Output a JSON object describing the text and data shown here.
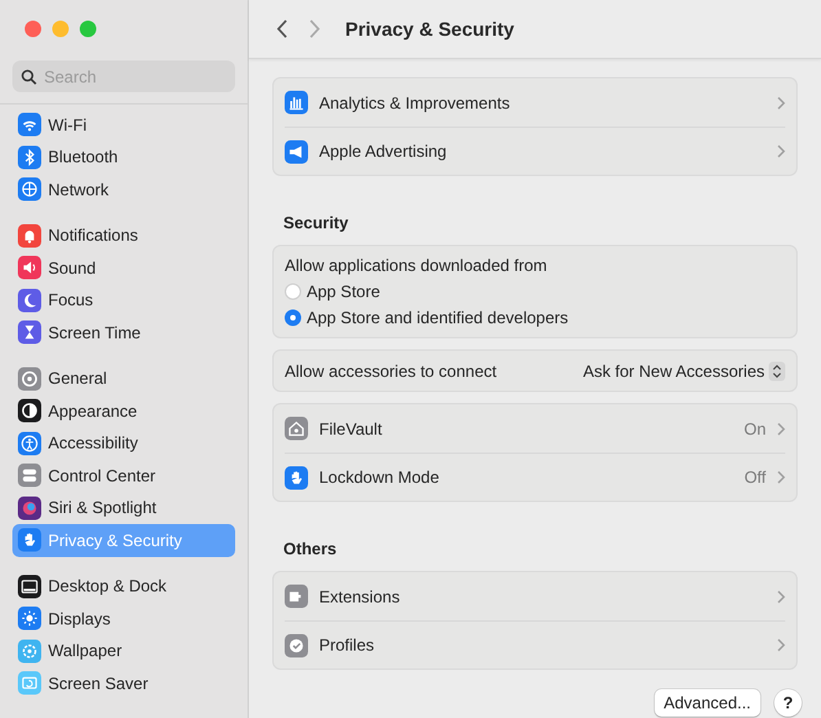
{
  "window": {
    "title": "Privacy & Security"
  },
  "sidebar": {
    "search": {
      "placeholder": "Search"
    },
    "groups": [
      [
        {
          "label": "Wi-Fi",
          "selected": false
        },
        {
          "label": "Bluetooth",
          "selected": false
        },
        {
          "label": "Network",
          "selected": false
        }
      ],
      [
        {
          "label": "Notifications",
          "selected": false
        },
        {
          "label": "Sound",
          "selected": false
        },
        {
          "label": "Focus",
          "selected": false
        },
        {
          "label": "Screen Time",
          "selected": false
        }
      ],
      [
        {
          "label": "General",
          "selected": false
        },
        {
          "label": "Appearance",
          "selected": false
        },
        {
          "label": "Accessibility",
          "selected": false
        },
        {
          "label": "Control Center",
          "selected": false
        },
        {
          "label": "Siri & Spotlight",
          "selected": false
        },
        {
          "label": "Privacy & Security",
          "selected": true
        }
      ],
      [
        {
          "label": "Desktop & Dock",
          "selected": false
        },
        {
          "label": "Displays",
          "selected": false
        },
        {
          "label": "Wallpaper",
          "selected": false
        },
        {
          "label": "Screen Saver",
          "selected": false
        }
      ]
    ]
  },
  "sections": [
    {
      "cards": [
        [
          {
            "kind": "nav",
            "label": "Analytics & Improvements"
          },
          {
            "kind": "nav",
            "label": "Apple Advertising"
          }
        ]
      ]
    },
    {
      "heading": "Security",
      "cards": [
        [
          {
            "kind": "radios",
            "label": "Allow applications downloaded from",
            "options": [
              {
                "label": "App Store",
                "selected": false
              },
              {
                "label": "App Store and identified developers",
                "selected": true
              }
            ]
          }
        ],
        [
          {
            "kind": "popup",
            "label": "Allow accessories to connect",
            "value": "Ask for New Accessories"
          }
        ],
        [
          {
            "kind": "nav",
            "label": "FileVault",
            "value": "On"
          },
          {
            "kind": "nav",
            "label": "Lockdown Mode",
            "value": "Off"
          }
        ]
      ]
    },
    {
      "heading": "Others",
      "cards": [
        [
          {
            "kind": "nav",
            "label": "Extensions"
          },
          {
            "kind": "nav",
            "label": "Profiles"
          }
        ]
      ]
    }
  ],
  "buttons": {
    "advanced": "Advanced...",
    "help": "?"
  }
}
